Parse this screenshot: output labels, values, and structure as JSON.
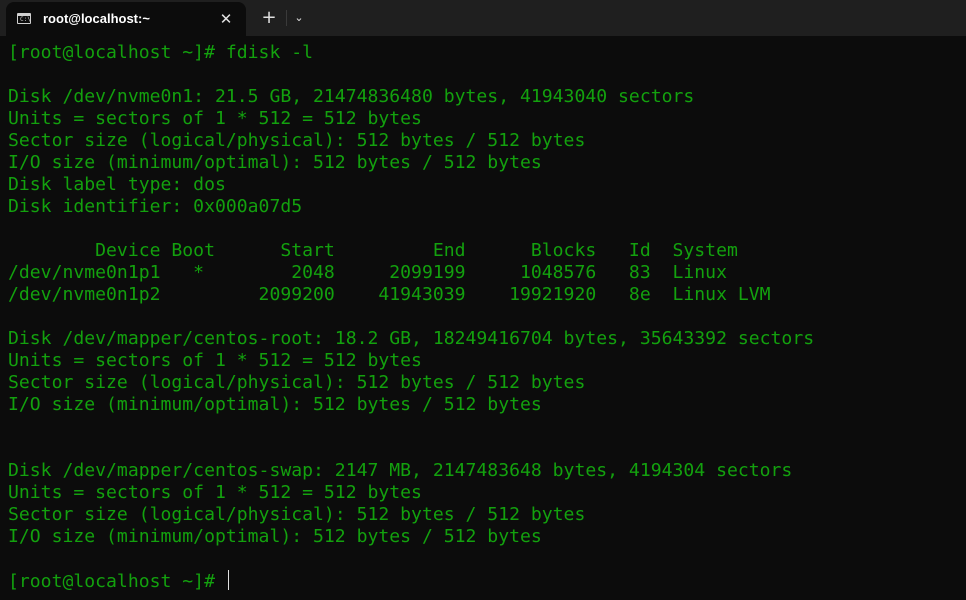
{
  "tab": {
    "icon": "terminal-icon",
    "icon_glyph": "C:\\",
    "title": "root@localhost:~",
    "close_glyph": "✕"
  },
  "titlebar": {
    "new_tab_glyph": "+",
    "dropdown_glyph": "⌄"
  },
  "colors": {
    "terminal_text": "#13a10e",
    "terminal_background": "#0c0c0c",
    "titlebar_background": "#1f1f1f"
  },
  "terminal": {
    "lines": [
      "[root@localhost ~]# fdisk -l",
      "",
      "Disk /dev/nvme0n1: 21.5 GB, 21474836480 bytes, 41943040 sectors",
      "Units = sectors of 1 * 512 = 512 bytes",
      "Sector size (logical/physical): 512 bytes / 512 bytes",
      "I/O size (minimum/optimal): 512 bytes / 512 bytes",
      "Disk label type: dos",
      "Disk identifier: 0x000a07d5",
      "",
      "        Device Boot      Start         End      Blocks   Id  System",
      "/dev/nvme0n1p1   *        2048     2099199     1048576   83  Linux",
      "/dev/nvme0n1p2         2099200    41943039    19921920   8e  Linux LVM",
      "",
      "Disk /dev/mapper/centos-root: 18.2 GB, 18249416704 bytes, 35643392 sectors",
      "Units = sectors of 1 * 512 = 512 bytes",
      "Sector size (logical/physical): 512 bytes / 512 bytes",
      "I/O size (minimum/optimal): 512 bytes / 512 bytes",
      "",
      "",
      "Disk /dev/mapper/centos-swap: 2147 MB, 2147483648 bytes, 4194304 sectors",
      "Units = sectors of 1 * 512 = 512 bytes",
      "Sector size (logical/physical): 512 bytes / 512 bytes",
      "I/O size (minimum/optimal): 512 bytes / 512 bytes",
      "",
      "[root@localhost ~]# "
    ]
  }
}
